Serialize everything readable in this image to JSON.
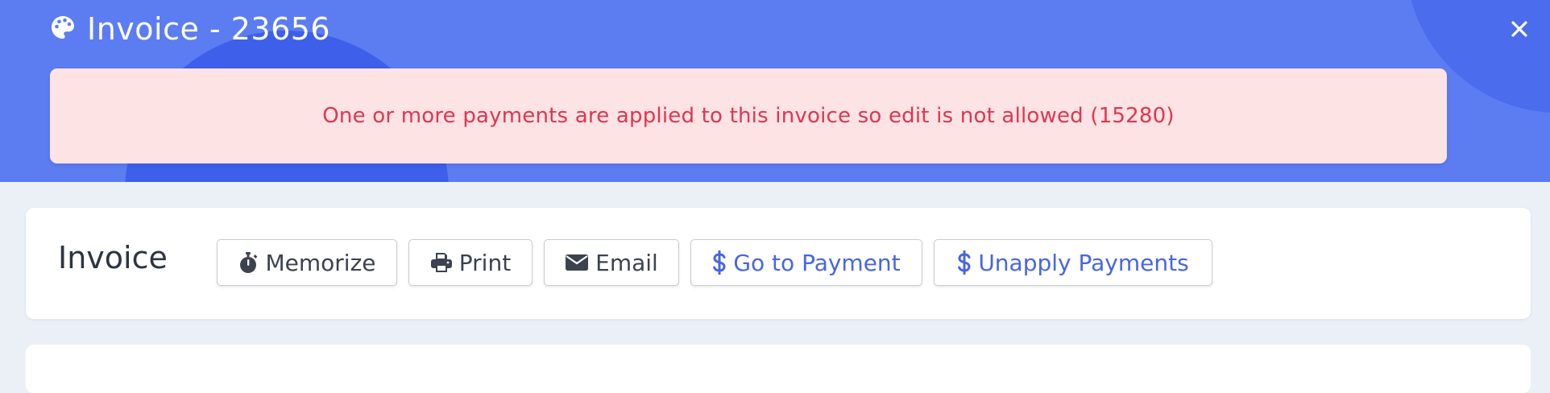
{
  "header": {
    "title": "Invoice - 23656",
    "title_icon": "palette-icon",
    "close_icon": "close-icon"
  },
  "alert": {
    "message": "One or more payments are applied to this invoice so edit is not allowed (15280)"
  },
  "toolbar": {
    "title": "Invoice",
    "buttons": [
      {
        "label": "Memorize",
        "icon": "stopwatch-icon"
      },
      {
        "label": "Print",
        "icon": "printer-icon"
      },
      {
        "label": "Email",
        "icon": "envelope-icon"
      },
      {
        "label": "Go to Payment",
        "icon": "dollar-icon"
      },
      {
        "label": "Unapply Payments",
        "icon": "dollar-icon"
      }
    ]
  },
  "colors": {
    "header_bg": "#5c7cf2",
    "alert_bg": "#fde3e4",
    "alert_text": "#e1354f",
    "link_blue": "#4765e6",
    "page_bg": "#ebf0f7"
  }
}
